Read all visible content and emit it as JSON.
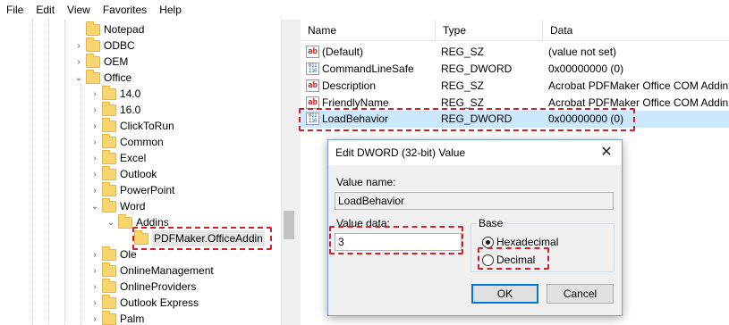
{
  "menu": {
    "items": [
      "File",
      "Edit",
      "View",
      "Favorites",
      "Help"
    ]
  },
  "tree": {
    "items": [
      {
        "label": "Notepad",
        "chev": ""
      },
      {
        "label": "ODBC",
        "chev": "›"
      },
      {
        "label": "OEM",
        "chev": "›"
      },
      {
        "label": "Office",
        "chev": "⌄"
      },
      {
        "label": "14.0",
        "chev": "›"
      },
      {
        "label": "16.0",
        "chev": "›"
      },
      {
        "label": "ClickToRun",
        "chev": "›"
      },
      {
        "label": "Common",
        "chev": "›"
      },
      {
        "label": "Excel",
        "chev": "›"
      },
      {
        "label": "Outlook",
        "chev": "›"
      },
      {
        "label": "PowerPoint",
        "chev": "›"
      },
      {
        "label": "Word",
        "chev": "⌄"
      },
      {
        "label": "Addins",
        "chev": "⌄"
      },
      {
        "label": "PDFMaker.OfficeAddin",
        "chev": ""
      },
      {
        "label": "Ole",
        "chev": "›"
      },
      {
        "label": "OnlineManagement",
        "chev": "›"
      },
      {
        "label": "OnlineProviders",
        "chev": "›"
      },
      {
        "label": "Outlook Express",
        "chev": "›"
      },
      {
        "label": "Palm",
        "chev": "›"
      }
    ]
  },
  "list": {
    "headers": {
      "name": "Name",
      "type": "Type",
      "data": "Data"
    },
    "rows": [
      {
        "name": "(Default)",
        "type": "REG_SZ",
        "data": "(value not set)",
        "icon": "string-value-icon"
      },
      {
        "name": "CommandLineSafe",
        "type": "REG_DWORD",
        "data": "0x00000000 (0)",
        "icon": "binary-value-icon"
      },
      {
        "name": "Description",
        "type": "REG_SZ",
        "data": "Acrobat PDFMaker Office COM Addin",
        "icon": "string-value-icon"
      },
      {
        "name": "FriendlyName",
        "type": "REG_SZ",
        "data": "Acrobat PDFMaker Office COM Addin",
        "icon": "string-value-icon"
      },
      {
        "name": "LoadBehavior",
        "type": "REG_DWORD",
        "data": "0x00000000 (0)",
        "icon": "binary-value-icon"
      }
    ]
  },
  "dialog": {
    "title": "Edit DWORD (32-bit) Value",
    "close": "✕",
    "value_name_label": "Value name:",
    "value_name": "LoadBehavior",
    "value_data_label": "Value data:",
    "value_data": "3",
    "base_label": "Base",
    "hex_label": "Hexadecimal",
    "dec_label": "Decimal",
    "base_selected": "Hexadecimal",
    "ok_label": "OK",
    "cancel_label": "Cancel"
  },
  "colors": {
    "highlight": "#d51f26",
    "selection": "#cce8ff"
  }
}
